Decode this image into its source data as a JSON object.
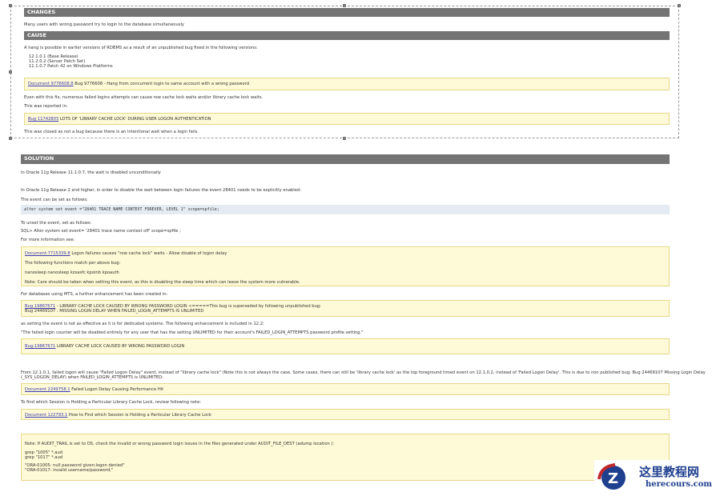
{
  "changes": {
    "title": "CHANGES",
    "text": "Many users with wrong password try to login to the database simultaneously"
  },
  "cause": {
    "title": "CAUSE",
    "intro": "A hang is possible in earlier versions of RDBMS as a result of an unpublished bug fixed in the following versions:",
    "versions": [
      "12.1.0.1 (Base Release)",
      "11.2.0.2 (Server Patch Set)",
      "11.1.0.7 Patch 42 on Windows Platforms"
    ],
    "ref1_link": "Document 9776608.8",
    "ref1_text": " Bug 9776608 - Hang from concurrent login to same account with a wrong password",
    "p1": "Even with this fix, numerous failed logins attempts can cause row cache lock waits and/or library cache lock waits.",
    "p2": "This was reported in:",
    "ref2_link": "Bug 11742803",
    "ref2_text": " LOTS OF 'LIBRARY CACHE LOCK' DURING USER LOGON AUTHENTICATION",
    "p3": "This was closed as not a bug because there is an intentional wait when a login fails."
  },
  "solution": {
    "title": "SOLUTION",
    "p1": "In Oracle 11g Release 11.1.0.7,  the wait is disabled unconditionally",
    "p2": "In Oracle 11g Release 2 and higher, in order to disable the wait between login failures the event 28401 needs to be explicitly enabled:",
    "p3": "The event can be set as follows:",
    "code": "alter system set event =\"28401 TRACE NAME CONTEXT FOREVER, LEVEL 1\" scope=spfile;",
    "p4": "To unset the event, set as follows:",
    "p5": "SQL> Alter system set event= '28401 trace name context off' scope=spfile ;",
    "p6": "For more information see:",
    "box1_link": "Document:7715339.8",
    "box1_text": " Logon failures causes \"row cache lock\" waits - Allow disable of logon delay",
    "box1_l2": "The following functions match per above bug:",
    "box1_l3": "nanosleep nanosleep kzsasfc kpoinb kpoauth",
    "box1_l4": "Note: Care should be taken when setting this event, as this is disabling the sleep time which can leave the system more vulnerable.",
    "p7": "For databases using MTS, a further enhancement has been created in:",
    "box2_link": "Bug 19867671",
    "box2_text": " - LIBRARY CACHE LOCK CAUSED BY WRONG PASSWORD LOGIN <=====This bug is superseded by following unpublished bug:",
    "box2_l2": "Bug 24469107 : MISSING LOGIN DELAY WHEN FAILED_LOGIN_ATTEMPTS IS UNLIMITED",
    "p8": "as setting the event is not as effective as it is for dedicated systems. The following enhancement is included in 12.2:",
    "p9": "\"The failed login counter will be disabled entirely for any user that has the setting UNLIMITED for their account's FAILED_LOGIN_ATTEMPTS password profile setting.\"",
    "box3_link": "Bug:19867671",
    "box3_text": " LIBRARY CACHE LOCK CAUSED BY WRONG PASSWORD LOGIN",
    "p10": "From 12.1.0.1, failed logon will cause \"Failed Logon Delay\" event, instead of \"library cache lock\" (Note this is not always the case. Some cases, there can still be 'library cache lock' as the top foreground timed event on 12.1.0.2, instead of 'Failed Logon Delay'.   This is due to non published bug: Bug 24469107 Missing Login Delay",
    "p10b": "(_SYS_LOGON_DELAY) when FAILED_LOGIN_ATTEMPTS is UNLIMITED:",
    "box4_link": "Document 2249758.1",
    "box4_text": " Failed Logon Delay Causing Performance Hit",
    "p11": "To find which Session is Holding a Particular Library Cache Lock, review following note:",
    "box5_link": "Document 122793.1",
    "box5_text": " How to Find which Session is Holding a Particular Library Cache Lock",
    "note_l1": "Note: If AUDIT_TRAIL is set to OS, check the invalid or wrong password login issues in the files generated under AUDIT_FILE_DEST (adump location ):",
    "note_l2": "grep \"1005\" *.aud",
    "note_l3": "grep \"1017\" *.aud",
    "note_l4": "\"ORA-01005: null password given;logon denied\"",
    "note_l5": "\"ORA-01017: invalid username/password;\""
  },
  "watermark": {
    "cn": "这里教程网",
    "en": "herecours.com"
  }
}
